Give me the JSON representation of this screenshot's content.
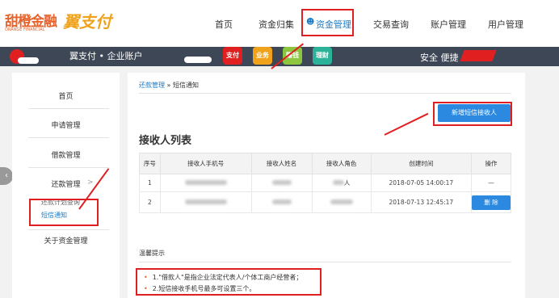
{
  "header": {
    "logo_cn": "甜橙金融",
    "logo_en": "ORANGE FINANCIAL",
    "logo_pay": "翼支付",
    "nav": [
      "首页",
      "资金归集",
      "资金管理",
      "交易查询",
      "账户管理",
      "用户管理"
    ],
    "active_icon": "user-icon"
  },
  "banner": {
    "title": "翼支付 • 企业账户",
    "badges": [
      "支付",
      "业务",
      "赚钱",
      "理财"
    ],
    "right": "安全  便捷"
  },
  "sidebar": {
    "items": [
      {
        "label": "首页"
      },
      {
        "label": "申请管理"
      },
      {
        "label": "借款管理"
      },
      {
        "label": "还款管理"
      },
      {
        "label": "关于资金管理"
      }
    ],
    "sub_items": [
      "还款计划查询",
      "短信通知"
    ],
    "expand_glyph": ">"
  },
  "breadcrumb": {
    "parent": "还款管理",
    "sep": " » ",
    "current": "短信通知"
  },
  "add_button": "新增短信接收人",
  "list_title": "接收人列表",
  "table": {
    "headers": [
      "序号",
      "接收人手机号",
      "接收人姓名",
      "接收人角色",
      "创建时间",
      "操作"
    ],
    "rows": [
      {
        "no": "1",
        "role_suffix": "人",
        "time": "2018-07-05 14:00:17",
        "op": "—"
      },
      {
        "no": "2",
        "time": "2018-07-13 12:45:17",
        "op": "删 除"
      }
    ]
  },
  "tips": {
    "heading": "温馨提示",
    "items": [
      "1.\"借款人\"是指企业法定代表人/个体工商户经营者；",
      "2.短信接收手机号最多可设置三个。"
    ]
  },
  "colors": {
    "accent": "#2b8ae0",
    "brand": "#e8632b",
    "highlight": "#e02020"
  }
}
